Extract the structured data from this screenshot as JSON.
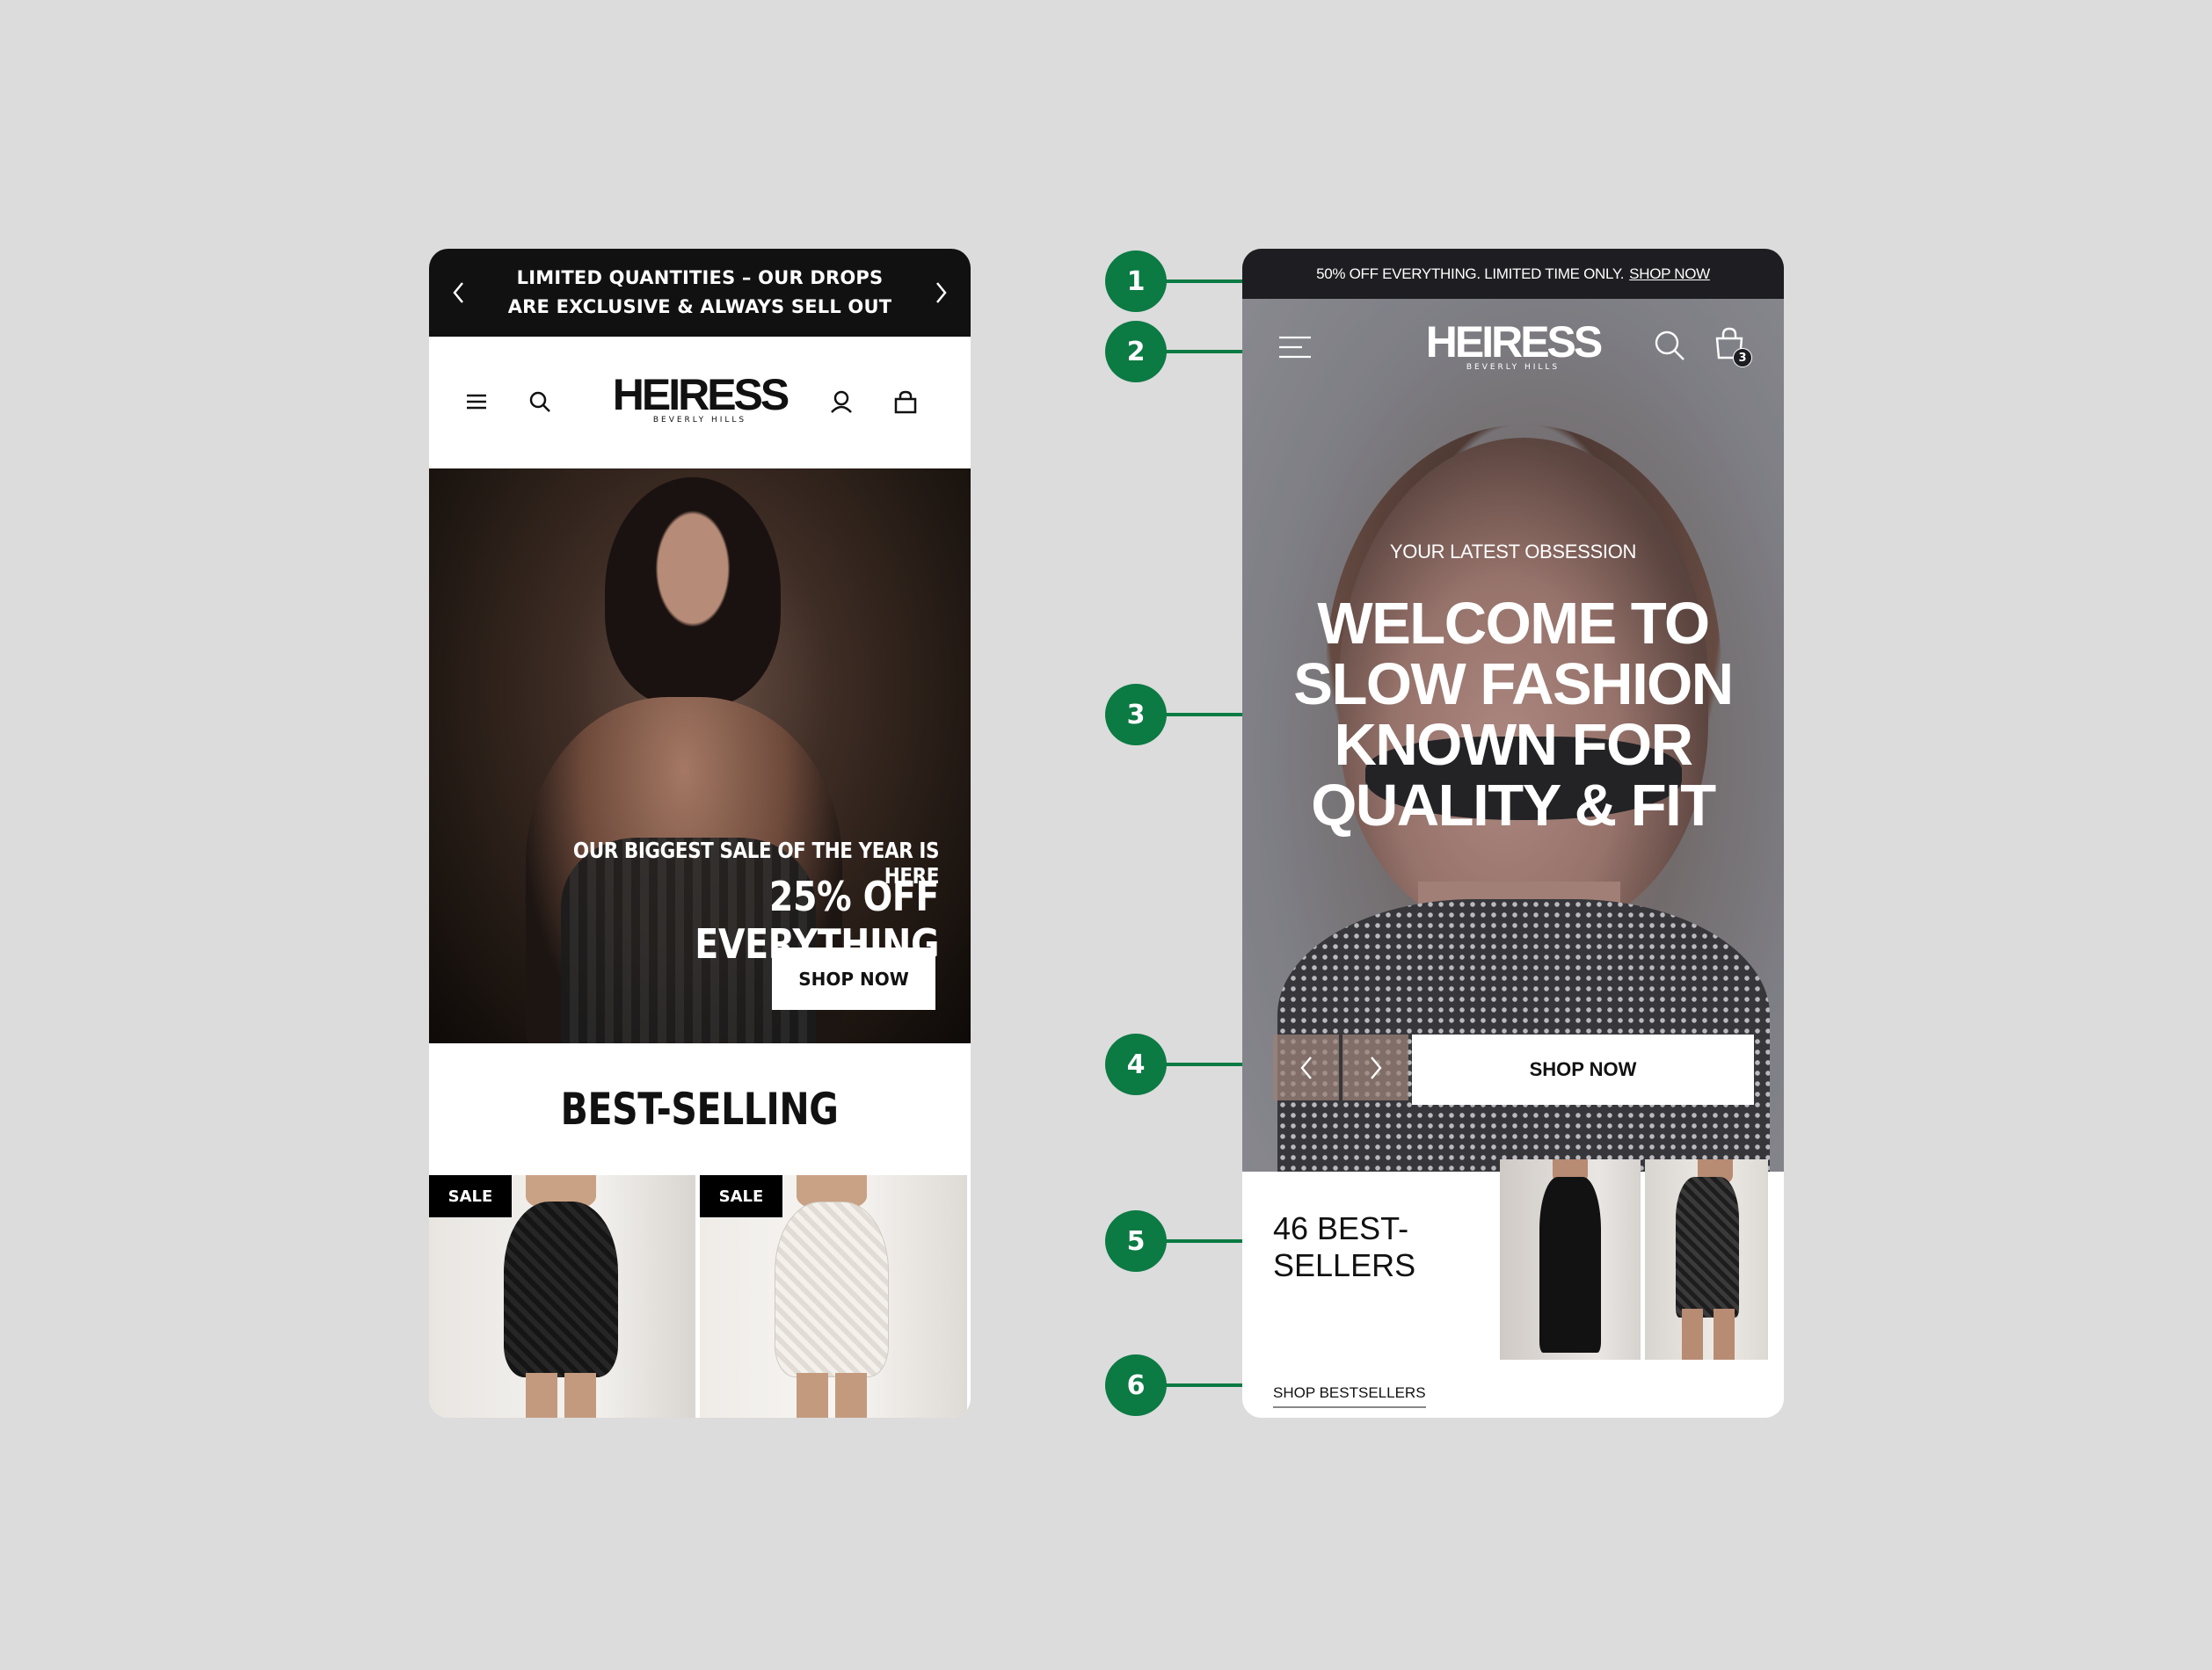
{
  "phone_a": {
    "announcement": {
      "text": "LIMITED QUANTITIES – OUR DROPS ARE EXCLUSIVE & ALWAYS SELL OUT",
      "prev_icon": "chevron-left-icon",
      "next_icon": "chevron-right-icon"
    },
    "header": {
      "logo_main": "HEIRESS",
      "logo_sub": "BEVERLY HILLS",
      "icons": [
        "menu-icon",
        "search-icon",
        "account-icon",
        "bag-icon"
      ]
    },
    "hero": {
      "subtitle": "OUR BIGGEST SALE OF THE YEAR IS HERE",
      "title": "25% OFF EVERYTHING",
      "cta": "SHOP NOW"
    },
    "best_selling": {
      "title": "BEST-SELLING",
      "products": [
        {
          "badge": "SALE"
        },
        {
          "badge": "SALE"
        }
      ]
    }
  },
  "phone_b": {
    "announcement": {
      "text": "50% OFF EVERYTHING. LIMITED TIME ONLY.",
      "link": "SHOP NOW"
    },
    "header": {
      "logo_main": "HEIRESS",
      "logo_sub": "BEVERLY HILLS",
      "cart_count": "3",
      "icons": [
        "menu-icon",
        "search-icon",
        "cart-icon"
      ]
    },
    "hero": {
      "eyebrow": "YOUR LATEST OBSESSION",
      "title": "WELCOME TO SLOW FASHION KNOWN FOR QUALITY & FIT",
      "cta": "SHOP NOW"
    },
    "bestsellers": {
      "count_text": "46 BEST-SELLERS",
      "link": "SHOP BESTSELLERS"
    }
  },
  "callouts": [
    "1",
    "2",
    "3",
    "4",
    "5",
    "6"
  ],
  "colors": {
    "background": "#dcdcdc",
    "callout_green": "#0b7a43",
    "dark": "#111111"
  }
}
